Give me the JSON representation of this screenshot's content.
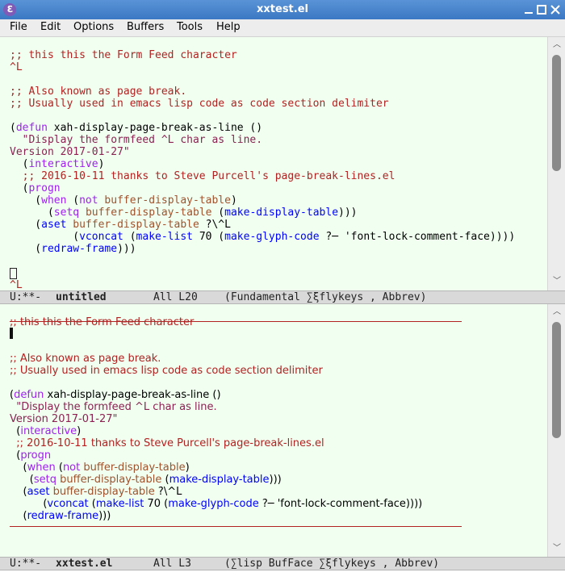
{
  "window": {
    "title": "xxtest.el",
    "app_icon": "emacs-icon",
    "controls": [
      "minimize-icon",
      "maximize-icon",
      "close-icon"
    ]
  },
  "menu": [
    "File",
    "Edit",
    "Options",
    "Buffers",
    "Tools",
    "Help"
  ],
  "top": {
    "lines": [
      ";; this this the Form Feed character",
      "^L",
      "",
      ";; Also known as page break.",
      ";; Usually used in emacs lisp code as code section delimiter",
      "",
      "(defun xah-display-page-break-as-line ()",
      "  \"Display the formfeed ^L char as line.",
      "Version 2017-01-27\"",
      "  (interactive)",
      "  ;; 2016-10-11 thanks to Steve Purcell's page-break-lines.el",
      "  (progn",
      "    (when (not buffer-display-table)",
      "      (setq buffer-display-table (make-display-table)))",
      "    (aset buffer-display-table ?\\^L",
      "          (vconcat (make-list 70 (make-glyph-code ?─ 'font-lock-comment-face))))",
      "    (redraw-frame)))",
      "",
      "",
      "^L"
    ],
    "modeline": {
      "status": "U:**-",
      "buffer": "untitled",
      "position": "All L20",
      "modes": "(Fundamental ∑ξflykeys , Abbrev)"
    }
  },
  "bottom": {
    "lines": [
      ";; this this the Form Feed character",
      "",
      "",
      ";; Also known as page break.",
      ";; Usually used in emacs lisp code as code section delimiter",
      "",
      "(defun xah-display-page-break-as-line ()",
      "  \"Display the formfeed ^L char as line.",
      "Version 2017-01-27\"",
      "  (interactive)",
      "  ;; 2016-10-11 thanks to Steve Purcell's page-break-lines.el",
      "  (progn",
      "    (when (not buffer-display-table)",
      "      (setq buffer-display-table (make-display-table)))",
      "    (aset buffer-display-table ?\\^L",
      "          (vconcat (make-list 70 (make-glyph-code ?─ 'font-lock-comment-face))))",
      "    (redraw-frame)))"
    ],
    "modeline": {
      "status": "U:**-",
      "buffer": "xxtest.el",
      "position": "All L3",
      "modes": "(∑lisp BufFace ∑ξflykeys , Abbrev)"
    }
  },
  "colors": {
    "comment": "#b22222",
    "string": "#8b2252",
    "keyword": "#a020f0",
    "function": "#0000ff",
    "variable": "#a0522d",
    "buffer_bg": "#f0fff0"
  }
}
